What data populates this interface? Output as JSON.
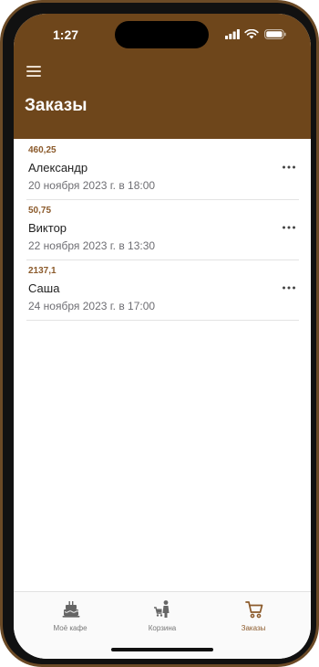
{
  "status": {
    "time": "1:27"
  },
  "header": {
    "title": "Заказы",
    "menu_icon": "hamburger-menu-icon"
  },
  "orders": [
    {
      "amount": "460,25",
      "name": "Александр",
      "date": "20 ноября 2023 г. в 18:00"
    },
    {
      "amount": "50,75",
      "name": "Виктор",
      "date": "22 ноября 2023 г. в 13:30"
    },
    {
      "amount": "2137,1",
      "name": "Саша",
      "date": "24 ноября 2023 г. в 17:00"
    }
  ],
  "tabs": [
    {
      "label": "Моё кафе",
      "icon": "cake-icon",
      "active": false
    },
    {
      "label": "Корзина",
      "icon": "person-cart-icon",
      "active": false
    },
    {
      "label": "Заказы",
      "icon": "cart-icon",
      "active": true
    }
  ],
  "colors": {
    "header": "#6e461b",
    "accent": "#8b5a2b",
    "frame": "#6b4a26"
  }
}
